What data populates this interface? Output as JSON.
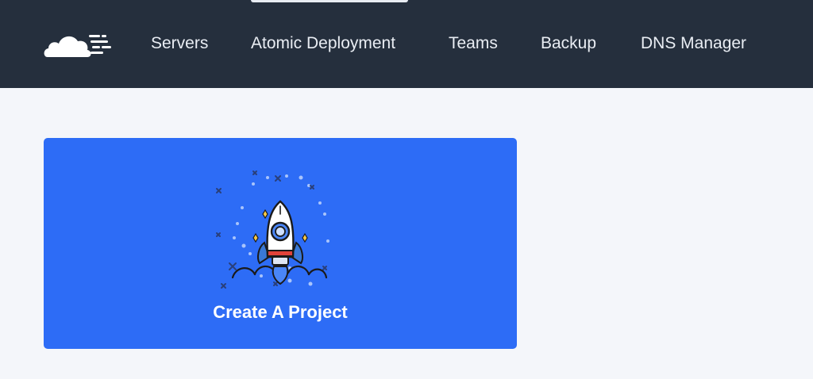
{
  "nav": {
    "items": [
      {
        "label": "Servers"
      },
      {
        "label": "Atomic Deployment"
      },
      {
        "label": "Teams"
      },
      {
        "label": "Backup"
      },
      {
        "label": "DNS Manager"
      }
    ]
  },
  "logo": {
    "icon": "cloud-icon"
  },
  "card": {
    "label": "Create A Project",
    "icon": "rocket-icon"
  },
  "colors": {
    "topbar": "#252f3d",
    "page_background": "#f4f6fa",
    "card": "#2d6cf6",
    "nav_text": "#e9edf3",
    "rocket_stripe": "#e0423a",
    "sparkle": "#f7c948"
  }
}
